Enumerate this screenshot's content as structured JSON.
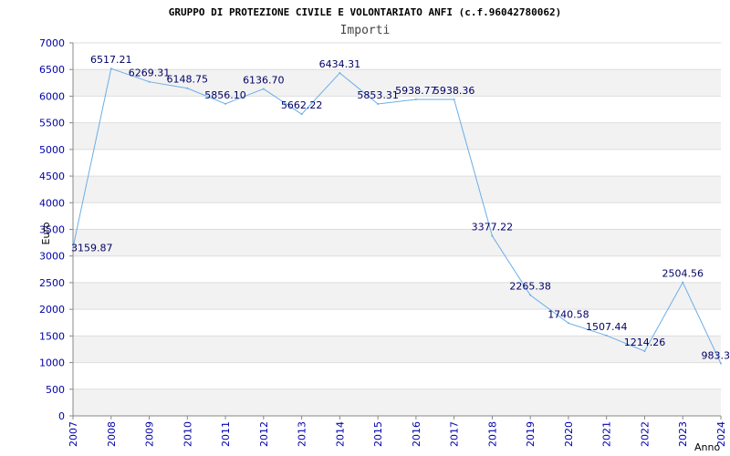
{
  "chart_data": {
    "type": "line",
    "title": "GRUPPO DI PROTEZIONE CIVILE E VOLONTARIATO ANFI (c.f.96042780062)",
    "subtitle": "Importi",
    "xlabel": "Anno",
    "ylabel": "Euro",
    "categories": [
      "2007",
      "2008",
      "2009",
      "2010",
      "2011",
      "2012",
      "2013",
      "2014",
      "2015",
      "2016",
      "2017",
      "2018",
      "2019",
      "2020",
      "2021",
      "2022",
      "2023",
      "2024"
    ],
    "values": [
      3159.87,
      6517.21,
      6269.31,
      6148.75,
      5856.1,
      6136.7,
      5662.22,
      6434.31,
      5853.31,
      5938.77,
      5938.36,
      3377.22,
      2265.38,
      1740.58,
      1507.44,
      1214.26,
      2504.56,
      983.3
    ],
    "value_labels": [
      "3159.87",
      "6517.21",
      "6269.31",
      "6148.75",
      "5856.10",
      "6136.70",
      "5662.22",
      "6434.31",
      "5853.31",
      "5938.77",
      "5938.36",
      "3377.22",
      "2265.38",
      "1740.58",
      "1507.44",
      "1214.26",
      "2504.56",
      "983.3"
    ],
    "ylim": [
      0,
      7000
    ],
    "yticks": [
      0,
      500,
      1000,
      1500,
      2000,
      2500,
      3000,
      3500,
      4000,
      4500,
      5000,
      5500,
      6000,
      6500,
      7000
    ],
    "grid": "horizontal alternating bands",
    "legend": "none",
    "colors": {
      "line": "#6aaee8",
      "band": "#f2f2f2",
      "gridline": "#dddddd",
      "axis": "#888888",
      "tick_text": "#0000aa",
      "data_label": "#000066"
    }
  }
}
